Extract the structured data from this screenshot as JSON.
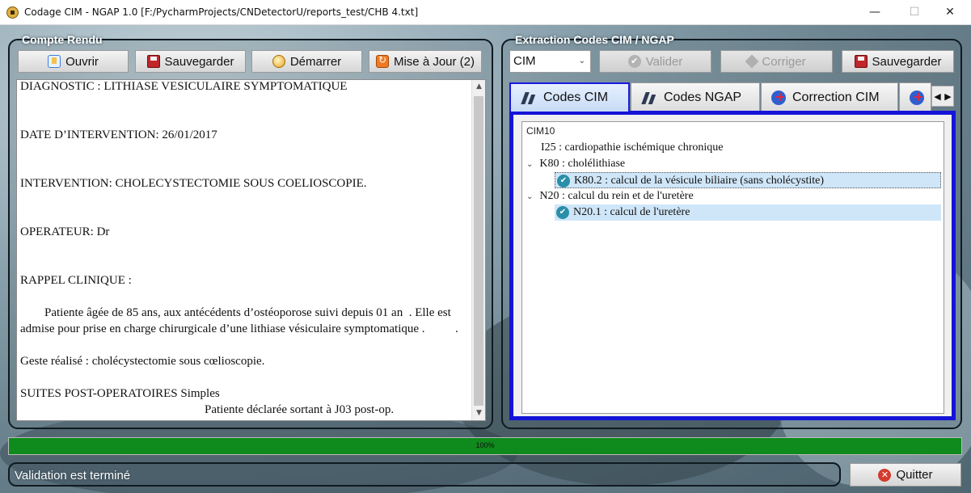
{
  "window": {
    "title": "Codage CIM - NGAP 1.0 [F:/PycharmProjects/CNDetectorU/reports_test/CHB 4.txt]",
    "minimize_glyph": "—",
    "maximize_glyph": "☐",
    "close_glyph": "✕"
  },
  "left_panel": {
    "title": "Compte Rendu",
    "buttons": {
      "open": "Ouvrir",
      "save": "Sauvegarder",
      "start": "Démarrer",
      "update": "Mise à Jour (2)"
    },
    "document_lines": [
      "DIAGNOSTIC : LITHIASE VESICULAIRE SYMPTOMATIQUE",
      "DATE D’INTERVENTION: 26/01/2017",
      "INTERVENTION: CHOLECYSTECTOMIE SOUS COELIOSCOPIE.",
      "OPERATEUR: Dr",
      "RAPPEL CLINIQUE :",
      "        Patiente âgée de 85 ans, aux antécédents d’ostéoporose suivi depuis 01 an  . Elle est",
      "admise pour prise en charge chirurgicale d’une lithiase vésiculaire symptomatique .          .",
      "Geste réalisé : cholécystectomie sous cœlioscopie.",
      "SUITES POST-OPERATOIRES Simples",
      "Patiente déclarée sortant à J03 post-op."
    ]
  },
  "right_panel": {
    "title": "Extraction Codes CIM / NGAP",
    "code_type_select": "CIM",
    "buttons": {
      "validate": "Valider",
      "correct": "Corriger",
      "save": "Sauvegarder"
    },
    "tabs": [
      {
        "label": "Codes CIM",
        "active": true
      },
      {
        "label": "Codes NGAP",
        "active": false
      },
      {
        "label": "Correction CIM",
        "active": false
      }
    ],
    "tree": {
      "root": "CIM10",
      "nodes": [
        {
          "label": "I25 : cardiopathie ischémique chronique",
          "level": 1
        },
        {
          "label": "K80 : cholélithiase",
          "level": 1,
          "expanded": true
        },
        {
          "label": "K80.2 : calcul de la vésicule biliaire (sans cholécystite)",
          "level": 2,
          "checked": true
        },
        {
          "label": "N20 : calcul du rein et de l'uretère",
          "level": 1,
          "expanded": true
        },
        {
          "label": "N20.1 : calcul de l'uretère",
          "level": 2,
          "checked": true
        }
      ]
    }
  },
  "progress": {
    "value": 1.0,
    "label": "100%",
    "color": "#0f8a1c"
  },
  "status": {
    "text": "Validation est terminé"
  },
  "quit_button": {
    "label": "Quitter"
  },
  "colors": {
    "tab_border": "#1414d8",
    "selected_row": "#cfe6f8"
  }
}
